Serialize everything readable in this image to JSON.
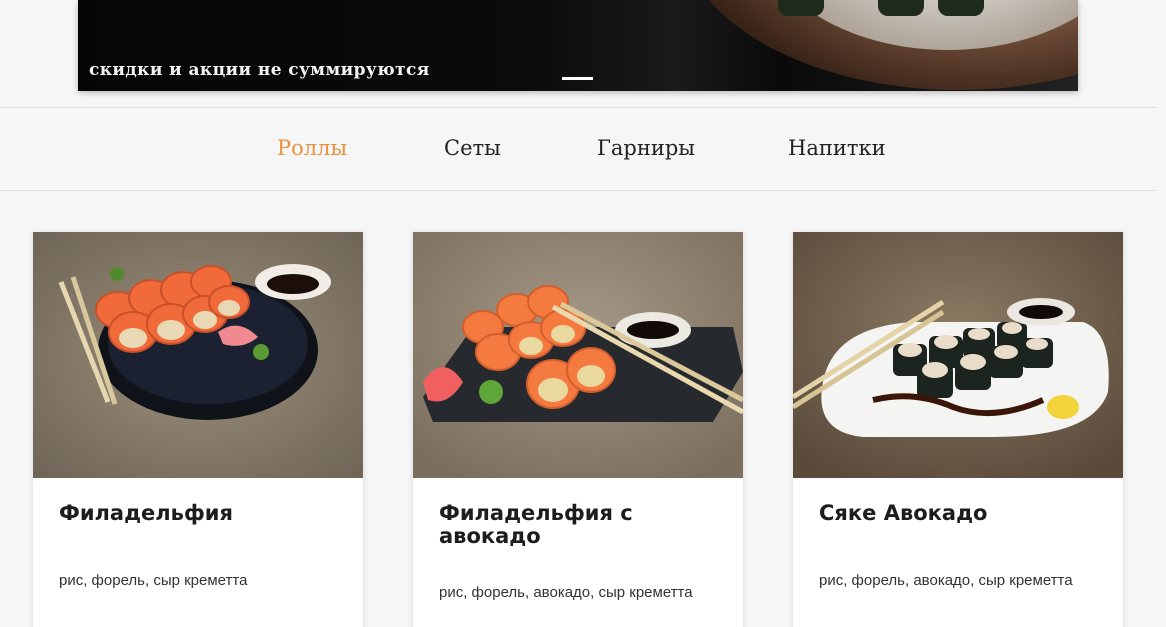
{
  "banner": {
    "caption": "скидки и акции не суммируются"
  },
  "nav": {
    "items": [
      {
        "label": "Роллы",
        "active": true
      },
      {
        "label": "Сеты",
        "active": false
      },
      {
        "label": "Гарниры",
        "active": false
      },
      {
        "label": "Напитки",
        "active": false
      }
    ],
    "active_color": "#e8913f"
  },
  "products": [
    {
      "title": "Филадельфия",
      "desc": "рис, форель, сыр креметта"
    },
    {
      "title": "Филадельфия с авокадо",
      "desc": "рис, форель, авокадо, сыр креметта"
    },
    {
      "title": "Сяке Авокадо",
      "desc": "рис, форель, авокадо, сыр креметта"
    }
  ]
}
